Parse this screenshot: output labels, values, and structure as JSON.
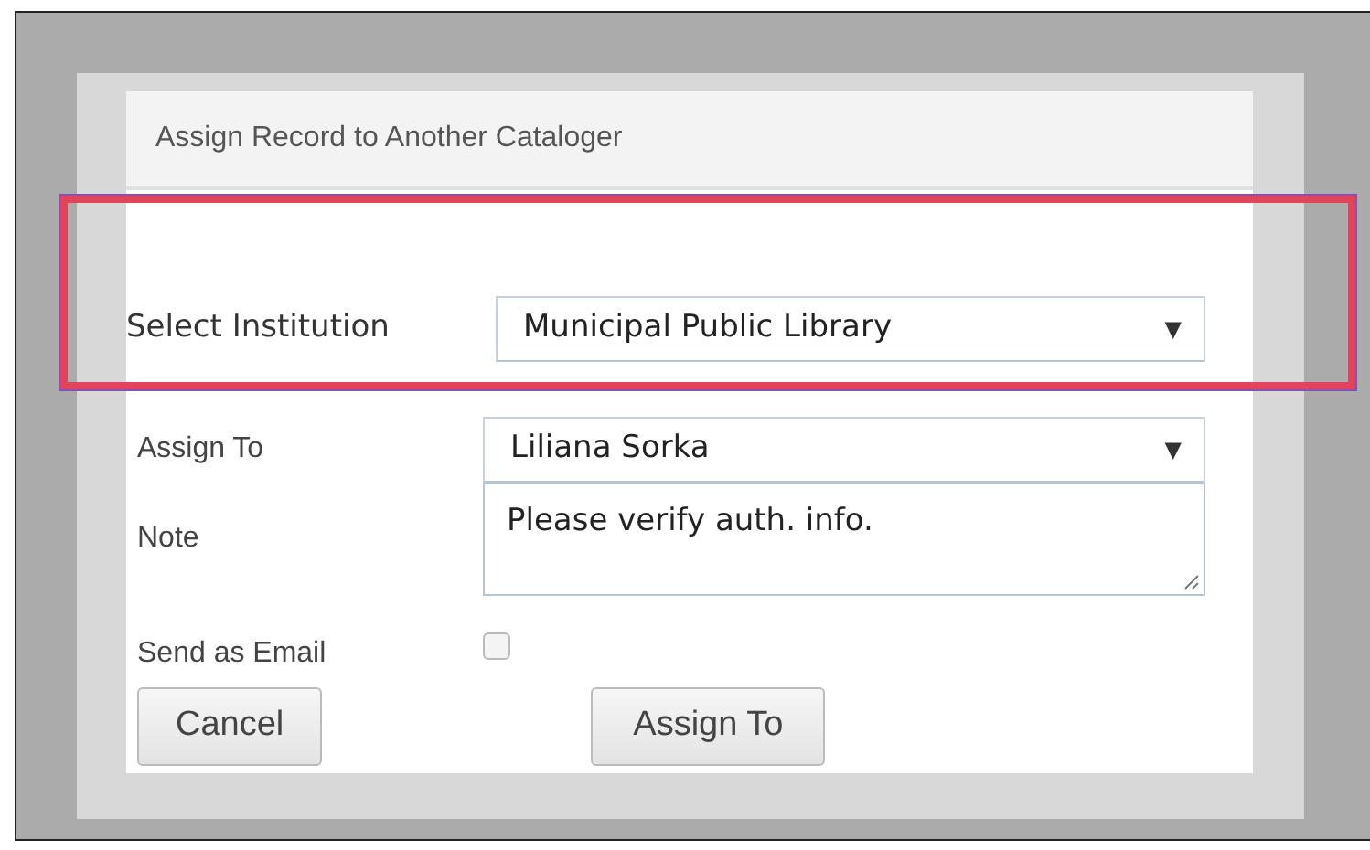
{
  "dialog": {
    "title": "Assign Record to Another Cataloger"
  },
  "fields": [
    {
      "kind": "select",
      "label": "Select Institution",
      "value": "Municipal Public Library",
      "arrow": "▼",
      "highlighted": true
    },
    {
      "kind": "select",
      "label": "Assign To",
      "value": "Liliana Sorka",
      "arrow": "▼",
      "highlighted": false
    },
    {
      "kind": "textarea",
      "label": "Note",
      "value": "Please verify auth. info.",
      "highlighted": false
    },
    {
      "kind": "checkbox",
      "label": "Send as Email",
      "checked": false,
      "highlighted": false
    }
  ],
  "buttons": [
    "Cancel",
    "Assign To"
  ]
}
